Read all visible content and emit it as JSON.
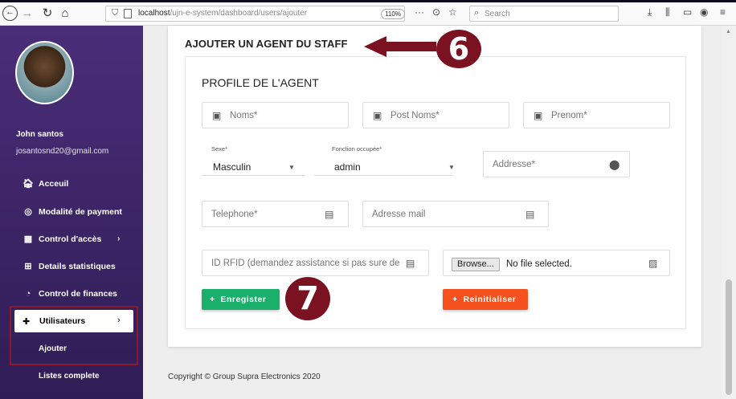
{
  "browser": {
    "url_host": "localhost",
    "url_path": "/ujn-e-system/dashboard/users/ajouter",
    "zoom": "110%",
    "search_placeholder": "Search"
  },
  "sidebar": {
    "user_name": "John santos",
    "user_email": "josantosnd20@gmail.com",
    "items": [
      {
        "label": "Acceuil",
        "icon": "home-icon"
      },
      {
        "label": "Modalité de payment",
        "icon": "payment-icon"
      },
      {
        "label": "Control d'accès",
        "icon": "access-control-icon",
        "arrow": "›"
      },
      {
        "label": "Details statistiques",
        "icon": "table-icon"
      },
      {
        "label": "Control de finances",
        "icon": "pie-chart-icon"
      }
    ],
    "active_item": {
      "label": "Utilisateurs",
      "icon": "users-icon",
      "arrow": "›"
    },
    "sub_items": [
      "Ajouter",
      "Listes complete"
    ]
  },
  "main": {
    "card_title": "AJOUTER UN AGENT DU STAFF",
    "section_title": "PROFILE DE L'AGENT",
    "fields": {
      "noms": "Noms*",
      "post_noms": "Post Noms*",
      "prenom": "Prenom*",
      "sexe_label": "Sexe*",
      "sexe_value": "Masculin",
      "fonction_label": "Fonction occupée*",
      "fonction_value": "admin",
      "adresse": "Addresse*",
      "telephone": "Telephone*",
      "mail": "Adresse mail",
      "rfid": "ID RFID (demandez assistance si pas sure de",
      "browse": "Browse...",
      "file_status": "No file selected."
    },
    "buttons": {
      "save": "Enregister",
      "reset": "Reinitialiser"
    },
    "footer": "Copyright © Group Supra Electronics 2020"
  },
  "annotations": {
    "step6": "6",
    "step7": "7"
  },
  "colors": {
    "sidebar_top": "#4a2d78",
    "sidebar_bottom": "#2f1d55",
    "save_button": "#1aaf6b",
    "reset_button": "#f4511e",
    "annotation": "#7a1221"
  }
}
